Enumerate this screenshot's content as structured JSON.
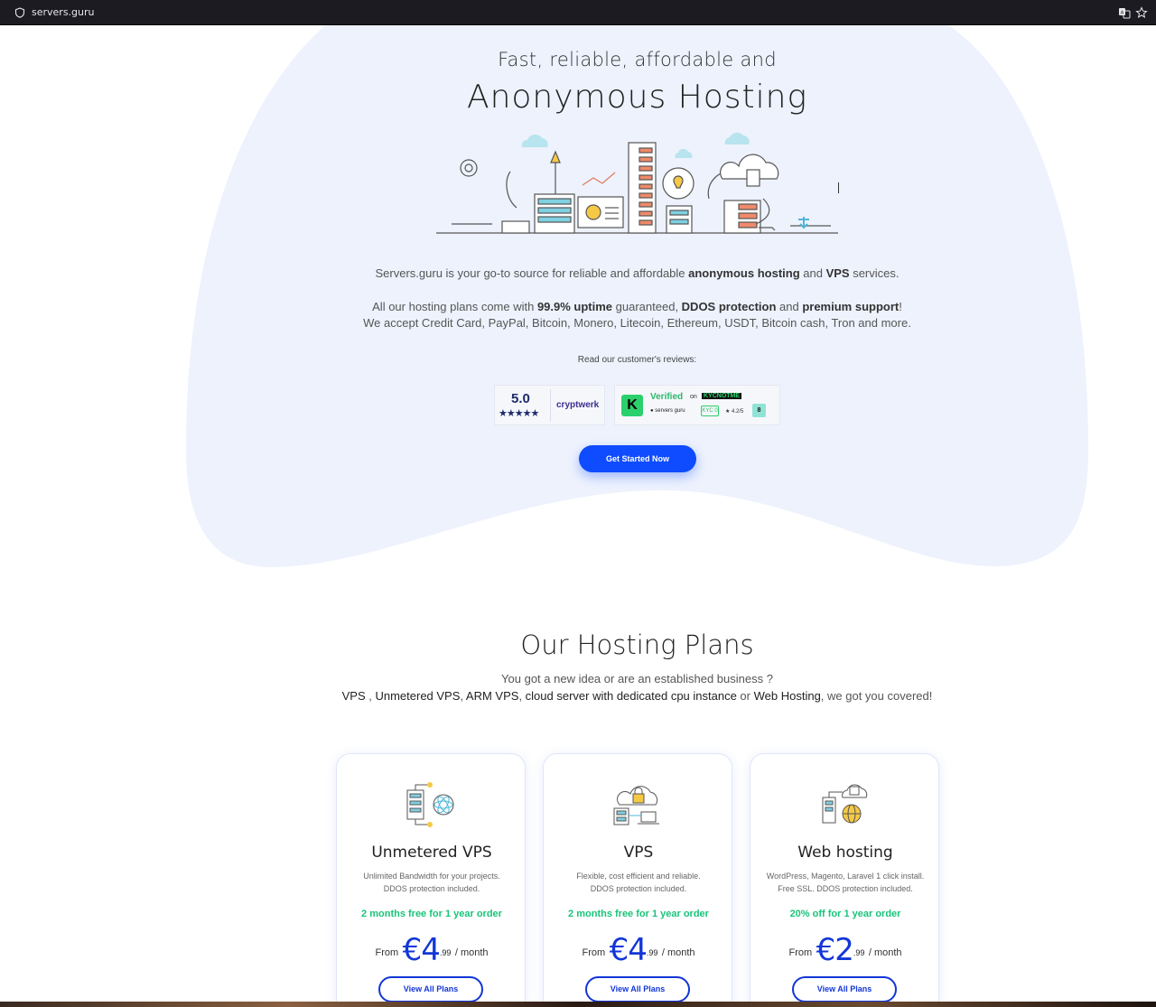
{
  "browser": {
    "url": "servers.guru"
  },
  "hero": {
    "subtitle": "Fast, reliable, affordable and",
    "title": "Anonymous Hosting",
    "p1_a": "Servers.guru is your go-to source for reliable and affordable ",
    "p1_b": "anonymous hosting",
    "p1_c": " and  ",
    "p1_d": "VPS",
    "p1_e": " services.",
    "p2_a": "All our hosting plans come with ",
    "p2_b": "99.9% uptime",
    "p2_c": " guaranteed, ",
    "p2_d": "DDOS protection",
    "p2_e": " and ",
    "p2_f": "premium support",
    "p2_g": "!",
    "p3": "We accept Credit Card, PayPal, Bitcoin, Monero, Litecoin, Ethereum, USDT, Bitcoin cash, Tron and more.",
    "reviews_label": "Read our customer's reviews:",
    "cta": "Get Started Now"
  },
  "badge_cryptwerk": {
    "score": "5.0",
    "stars": "★★★★★",
    "brand": "cryptwerk"
  },
  "badge_kycnotme": {
    "logo": "K",
    "verified": "Verified",
    "on": "on",
    "brand": "KYCNOTME",
    "site": "● servers guru",
    "pill": "KYC 0",
    "rating": "★ 4.2/5",
    "score": "8"
  },
  "plans": {
    "title": "Our Hosting Plans",
    "sub1": "You got a new idea or are an established business ?",
    "sub2_a": "VPS",
    "sub2_b": " , ",
    "sub2_c": "Unmetered VPS",
    "sub2_d": ", ",
    "sub2_e": "ARM VPS",
    "sub2_f": ", ",
    "sub2_g": "cloud server with dedicated cpu instance",
    "sub2_h": " or ",
    "sub2_i": "Web Hosting",
    "sub2_j": ", we got you covered!",
    "cards": [
      {
        "name": "Unmetered VPS",
        "desc1": "Unlimited Bandwidth for your projects.",
        "desc2": "DDOS protection included.",
        "promo": "2 months free for 1 year order",
        "from": "From",
        "price": "€4",
        "cents": ".99",
        "per": "/  month",
        "button": "View All Plans",
        "icon": "server-atom-icon"
      },
      {
        "name": "VPS",
        "desc1": "Flexible, cost efficient and reliable.",
        "desc2": "DDOS protection included.",
        "promo": "2 months free for 1 year order",
        "from": "From",
        "price": "€4",
        "cents": ".99",
        "per": "/  month",
        "button": "View All Plans",
        "icon": "cloud-lock-icon"
      },
      {
        "name": "Web hosting",
        "desc1": "WordPress, Magento, Laravel 1 click install.",
        "desc2": "Free SSL. DDOS protection included.",
        "promo": "20% off for 1 year order",
        "from": "From",
        "price": "€2",
        "cents": ".99",
        "per": "/  month",
        "button": "View All Plans",
        "icon": "globe-server-icon"
      }
    ]
  },
  "colors": {
    "accent": "#0f4bff",
    "price": "#1236d8",
    "promo": "#19c47a",
    "blob": "#edf2fd"
  }
}
